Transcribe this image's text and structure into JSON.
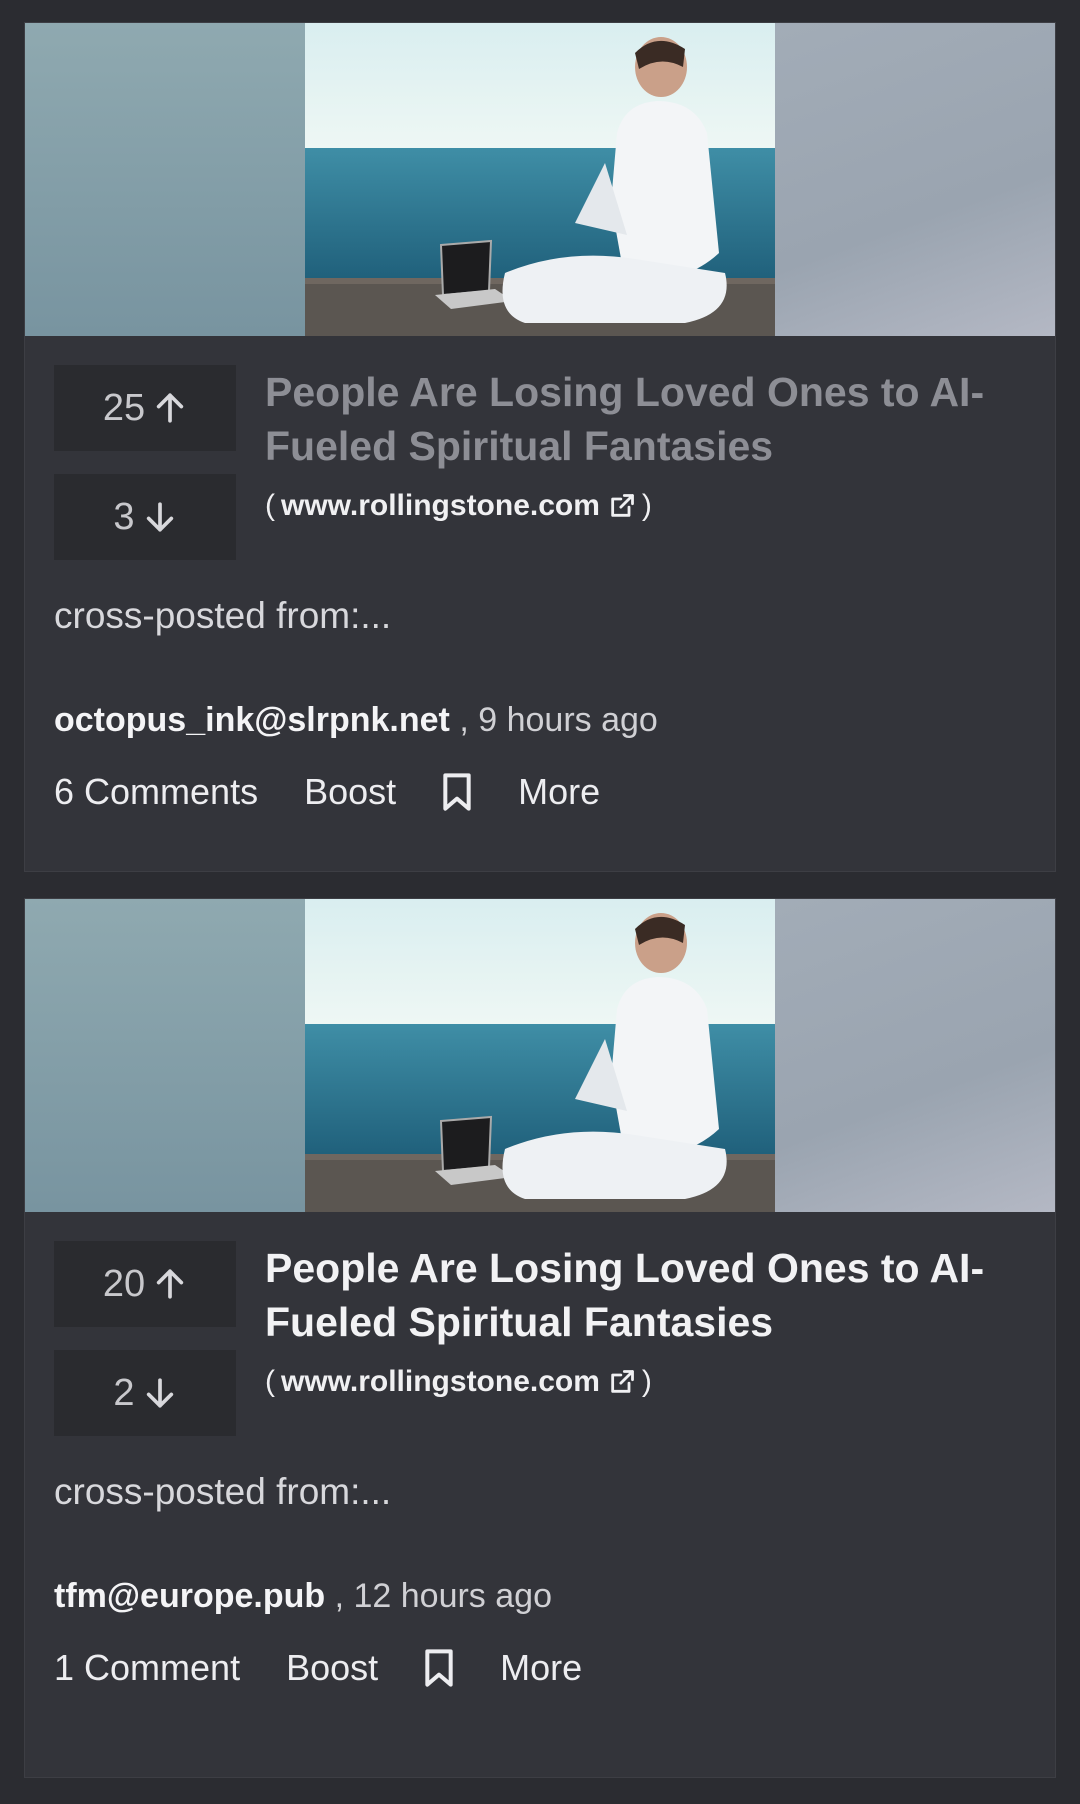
{
  "posts": [
    {
      "upvotes": "25",
      "downvotes": "3",
      "title": "People Are Losing Loved Ones to AI-Fueled Spiritual Fantasies",
      "domain_open": "(",
      "domain": "www.rollingstone.com",
      "domain_close": ")",
      "excerpt": "cross-posted from:...",
      "author": "octopus_ink@slrpnk.net",
      "time": ", 9 hours ago",
      "comments": "6 Comments",
      "boost": "Boost",
      "more": "More"
    },
    {
      "upvotes": "20",
      "downvotes": "2",
      "title": "People Are Losing Loved Ones to AI-Fueled Spiritual Fantasies",
      "domain_open": "(",
      "domain": "www.rollingstone.com",
      "domain_close": ")",
      "excerpt": "cross-posted from:...",
      "author": "tfm@europe.pub",
      "time": ", 12 hours ago",
      "comments": "1 Comment",
      "boost": "Boost",
      "more": "More"
    }
  ],
  "icons": {
    "upvote": "arrow-up-icon",
    "downvote": "arrow-down-icon",
    "external": "external-link-icon",
    "bookmark": "bookmark-icon"
  },
  "colors": {
    "background": "#2b2c31",
    "card": "#33343a",
    "vote_box": "#2a2b2f",
    "title_visited": "#8d8e95",
    "title": "#f2f2f4"
  }
}
